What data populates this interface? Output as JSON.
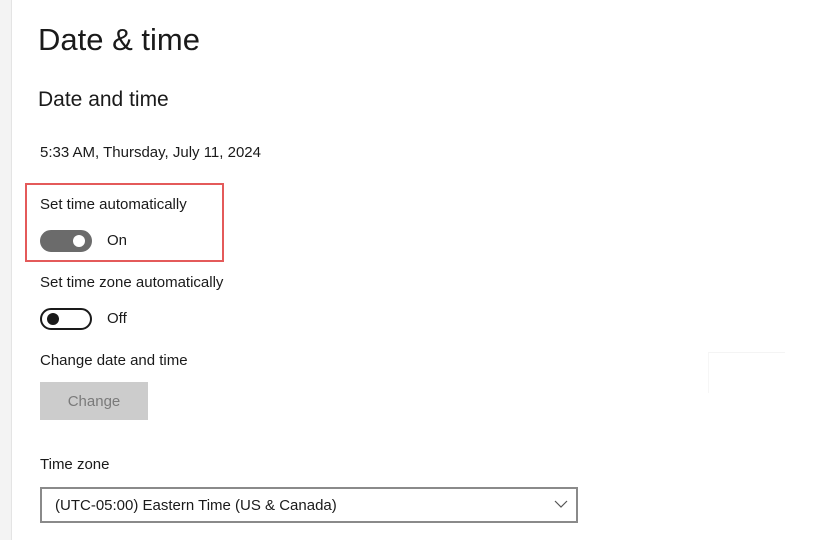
{
  "page": {
    "title": "Date & time"
  },
  "date_and_time": {
    "section_title": "Date and time",
    "current_datetime": "5:33 AM, Thursday, July 11, 2024",
    "set_time_automatically": {
      "label": "Set time automatically",
      "state_text": "On",
      "on": true
    },
    "set_time_zone_automatically": {
      "label": "Set time zone automatically",
      "state_text": "Off",
      "on": false
    },
    "change_date_and_time": {
      "label": "Change date and time",
      "button_label": "Change",
      "button_enabled": false
    },
    "time_zone": {
      "label": "Time zone",
      "selected": "(UTC-05:00) Eastern Time (US & Canada)"
    }
  },
  "colors": {
    "highlight_border": "#e45a5a",
    "toggle_on": "#6b6b6b",
    "button_disabled_bg": "#cccccc",
    "button_disabled_text": "#7a7a7a"
  },
  "icons": {
    "dropdown": "chevron-down-icon"
  }
}
